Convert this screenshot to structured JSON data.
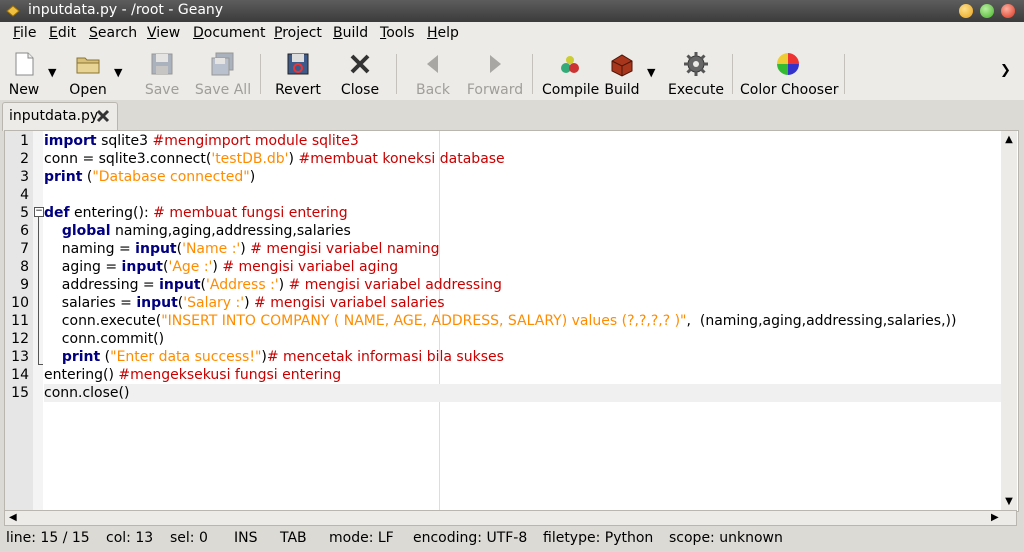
{
  "window": {
    "title": "inputdata.py - /root - Geany"
  },
  "menu": [
    {
      "ul": "F",
      "rest": "ile"
    },
    {
      "ul": "E",
      "rest": "dit"
    },
    {
      "ul": "S",
      "rest": "earch"
    },
    {
      "ul": "V",
      "rest": "iew"
    },
    {
      "ul": "D",
      "rest": "ocument"
    },
    {
      "ul": "P",
      "rest": "roject"
    },
    {
      "ul": "B",
      "rest": "uild"
    },
    {
      "ul": "T",
      "rest": "ools"
    },
    {
      "ul": "H",
      "rest": "elp"
    }
  ],
  "toolbar": {
    "new": "New",
    "open": "Open",
    "save": "Save",
    "save_all": "Save All",
    "revert": "Revert",
    "close": "Close",
    "back": "Back",
    "forward": "Forward",
    "compile": "Compile",
    "build": "Build",
    "execute": "Execute",
    "color_chooser": "Color Chooser"
  },
  "tab": {
    "label": "inputdata.py"
  },
  "code": {
    "lines": [
      [
        {
          "t": "import",
          "c": "kw"
        },
        {
          "t": " sqlite3 "
        },
        {
          "t": "#mengimport module sqlite3",
          "c": "cm"
        }
      ],
      [
        {
          "t": "conn = sqlite3.connect("
        },
        {
          "t": "'testDB.db'",
          "c": "st"
        },
        {
          "t": ") "
        },
        {
          "t": "#membuat koneksi database",
          "c": "cm"
        }
      ],
      [
        {
          "t": "print",
          "c": "kw"
        },
        {
          "t": " ("
        },
        {
          "t": "\"Database connected\"",
          "c": "st"
        },
        {
          "t": ")"
        }
      ],
      [],
      [
        {
          "t": "def",
          "c": "kw"
        },
        {
          "t": " entering(): "
        },
        {
          "t": "# membuat fungsi entering",
          "c": "cm"
        }
      ],
      [
        {
          "t": "    "
        },
        {
          "t": "global",
          "c": "kw"
        },
        {
          "t": " naming,aging,addressing,salaries"
        }
      ],
      [
        {
          "t": "    naming = "
        },
        {
          "t": "input",
          "c": "kw"
        },
        {
          "t": "("
        },
        {
          "t": "'Name :'",
          "c": "st"
        },
        {
          "t": ") "
        },
        {
          "t": "# mengisi variabel naming",
          "c": "cm"
        }
      ],
      [
        {
          "t": "    aging = "
        },
        {
          "t": "input",
          "c": "kw"
        },
        {
          "t": "("
        },
        {
          "t": "'Age :'",
          "c": "st"
        },
        {
          "t": ") "
        },
        {
          "t": "# mengisi variabel aging",
          "c": "cm"
        }
      ],
      [
        {
          "t": "    addressing = "
        },
        {
          "t": "input",
          "c": "kw"
        },
        {
          "t": "("
        },
        {
          "t": "'Address :'",
          "c": "st"
        },
        {
          "t": ") "
        },
        {
          "t": "# mengisi variabel addressing",
          "c": "cm"
        }
      ],
      [
        {
          "t": "    salaries = "
        },
        {
          "t": "input",
          "c": "kw"
        },
        {
          "t": "("
        },
        {
          "t": "'Salary :'",
          "c": "st"
        },
        {
          "t": ") "
        },
        {
          "t": "# mengisi variabel salaries",
          "c": "cm"
        }
      ],
      [
        {
          "t": "    conn.execute("
        },
        {
          "t": "\"INSERT INTO COMPANY ( NAME, AGE, ADDRESS, SALARY) values (?,?,?,? )\"",
          "c": "st"
        },
        {
          "t": ",  (naming,aging,addressing,salaries,))"
        }
      ],
      [
        {
          "t": "    conn.commit()"
        }
      ],
      [
        {
          "t": "    "
        },
        {
          "t": "print",
          "c": "kw"
        },
        {
          "t": " ("
        },
        {
          "t": "\"Enter data success!\"",
          "c": "st"
        },
        {
          "t": ")"
        },
        {
          "t": "# mencetak informasi bila sukses",
          "c": "cm"
        }
      ],
      [
        {
          "t": "entering() "
        },
        {
          "t": "#mengeksekusi fungsi entering",
          "c": "cm"
        }
      ],
      [
        {
          "t": "conn.close()"
        }
      ]
    ],
    "current_line": 15
  },
  "status": {
    "line": "line: 15 / 15",
    "col": "col: 13",
    "sel": "sel: 0",
    "ins": "INS",
    "tab": "TAB",
    "mode": "mode: LF",
    "encoding": "encoding: UTF-8",
    "filetype": "filetype: Python",
    "scope": "scope: unknown"
  }
}
